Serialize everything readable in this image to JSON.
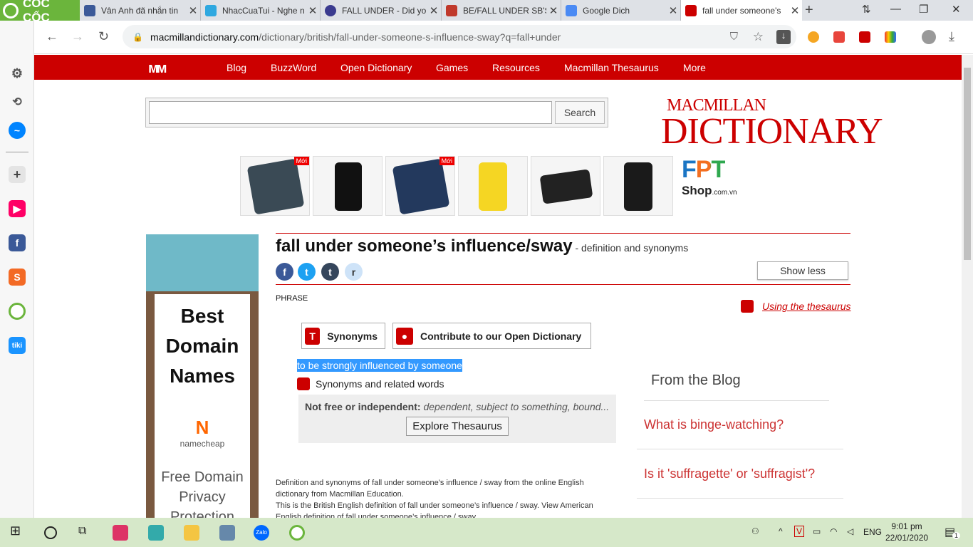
{
  "browser": {
    "brand": "CỐC CỐC",
    "tabs": [
      {
        "title": "Vân Anh đã nhắn tin",
        "favicon": "facebook-icon"
      },
      {
        "title": "NhacCuaTui - Nghe n",
        "favicon": "nhaccuatui-icon"
      },
      {
        "title": "FALL UNDER - Did yo",
        "favicon": "globe-icon"
      },
      {
        "title": "BE/FALL UNDER SB'S",
        "favicon": "cambridge-icon"
      },
      {
        "title": "Google Dich",
        "favicon": "google-translate-icon"
      },
      {
        "title": "fall under someone's",
        "favicon": "macmillan-icon"
      }
    ],
    "url_host": "macmillandictionary.com",
    "url_path": "/dictionary/british/fall-under-someone-s-influence-sway?q=fall+under"
  },
  "site": {
    "nav": [
      "Blog",
      "BuzzWord",
      "Open Dictionary",
      "Games",
      "Resources",
      "Macmillan Thesaurus",
      "More"
    ],
    "search_button": "Search",
    "search_value": "",
    "brand_line1": "MACMILLAN",
    "brand_line2": "DICTIONARY"
  },
  "ad_strip": {
    "new_badge": "Mới",
    "fpt_logo": "FPT",
    "fpt_shop": "Shop",
    "fpt_domain": ".com.vn"
  },
  "left_ad": {
    "headline": "Best Domain Names",
    "brand": "namecheap",
    "tagline": "Free Domain Privacy Protection"
  },
  "entry": {
    "headword": "fall under someone’s influence/sway",
    "suffix": " - definition and synonyms",
    "show_less": "Show less",
    "part_of_speech": "PHRASE",
    "using_thesaurus": "Using the thesaurus",
    "synonyms_button": "Synonyms",
    "contribute_button": "Contribute to our Open Dictionary",
    "definition": "to be strongly influenced by someone",
    "synonyms_related": "Synonyms and related words",
    "thes_label": "Not free or independent:",
    "thes_words": " dependent, subject to something, bound...",
    "explore": "Explore Thesaurus",
    "footer1": "Definition and synonyms of fall under someone’s influence / sway from the online English dictionary from Macmillan Education.",
    "footer2": "This is the British English definition of fall under someone’s influence / sway. View American English definition of fall under someone’s influence / sway."
  },
  "blog": {
    "title": "From the Blog",
    "links": [
      "What is binge-watching?",
      "Is it 'suffragette' or 'suffragist'?"
    ]
  },
  "taskbar": {
    "language": "ENG",
    "time": "9:01 pm",
    "date": "22/01/2020",
    "notifications": "1",
    "zalo": "Zalo"
  },
  "colors": {
    "brand_red": "#cc0000",
    "coccoc_green": "#6bb53c",
    "selection": "#3399ff"
  }
}
